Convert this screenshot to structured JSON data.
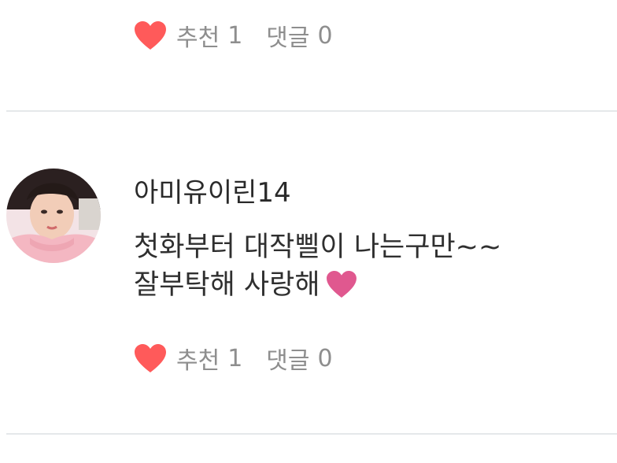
{
  "top_comment": {
    "like_label": "추천",
    "like_count": "1",
    "reply_label": "댓글",
    "reply_count": "0"
  },
  "comment": {
    "username": "아미유이린14",
    "text_line1": "첫화부터 대작삘이 나는구만~~",
    "text_line2": "잘부탁해 사랑해",
    "emoji": "pink-heart",
    "like_label": "추천",
    "like_count": "1",
    "reply_label": "댓글",
    "reply_count": "0"
  },
  "colors": {
    "like_heart": "#ff5a5a",
    "emoji_heart": "#e0588f",
    "meta_text": "#8e8e8e",
    "divider": "#e5e8ea"
  }
}
